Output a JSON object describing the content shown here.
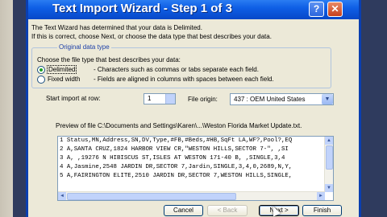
{
  "window": {
    "title": "Text Import Wizard - Step 1 of 3",
    "help_label": "?",
    "close_label": "✕"
  },
  "intro": {
    "line1": "The Text Wizard has determined that your data is Delimited.",
    "line2": "If this is correct, choose Next, or choose the data type that best describes your data."
  },
  "original_data_type": {
    "group_label": "Original data type",
    "choose_label": "Choose the file type that best describes your data:",
    "options": [
      {
        "label": "Delimited",
        "description": "- Characters such as commas or tabs separate each field.",
        "checked": true
      },
      {
        "label": "Fixed width",
        "description": "- Fields are aligned in columns with spaces between each field.",
        "checked": false
      }
    ]
  },
  "start_import": {
    "label": "Start import at row:",
    "value": "1"
  },
  "file_origin": {
    "label": "File origin:",
    "value": "437 : OEM United States"
  },
  "preview": {
    "label": "Preview of file C:\\Documents and Settings\\Karen\\...\\Weston Florida Market Update.txt.",
    "lines": [
      "1 Status,MN,Address,SN,DV,Type,#FB,#Beds,#HB,SqFt LA,WF?,Pool?,EQ",
      "2 A,SANTA CRUZ,1824 HARBOR VIEW CR,\"WESTON HILLS,SECTOR 7-\", ,SI",
      "3 A, ,19276 N HIBISCUS ST,ISLES AT WESTON 171-40 B, ,SINGLE,3,4",
      "4 A,Jasmine,2548 JARDIN DR,SECTOR 7,Jardin,SINGLE,3,4,0,2689,N,Y,",
      "5 A,FAIRINGTON ELITE,2510 JARDIN DR,SECTOR 7,WESTON HILLS,SINGLE,"
    ]
  },
  "buttons": {
    "cancel": "Cancel",
    "back": "< Back",
    "next": "Next >",
    "finish": "Finish"
  },
  "colors": {
    "title_bar": "#0748c8",
    "client_bg": "#ece9d8",
    "group_label": "#1c3fa8",
    "radio_dot": "#21a121"
  }
}
